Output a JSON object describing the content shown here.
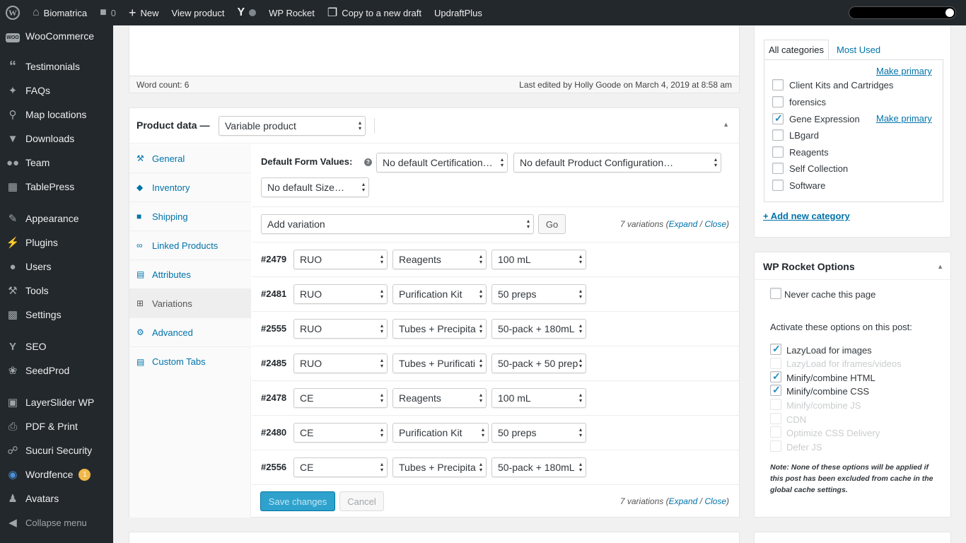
{
  "admin_bar": {
    "site_name": "Biomatrica",
    "comments_count": "0",
    "new_label": "New",
    "view_product_label": "View product",
    "wp_rocket_label": "WP Rocket",
    "copy_draft_label": "Copy to a new draft",
    "updraft_label": "UpdraftPlus"
  },
  "sidebar": {
    "items": [
      {
        "label": "WooCommerce",
        "icon": "woocommerce-icon"
      },
      {
        "label": "Testimonials",
        "icon": "quote-icon"
      },
      {
        "label": "FAQs",
        "icon": "pin-icon"
      },
      {
        "label": "Map locations",
        "icon": "map-pin-icon"
      },
      {
        "label": "Downloads",
        "icon": "download-icon"
      },
      {
        "label": "Team",
        "icon": "team-icon"
      },
      {
        "label": "TablePress",
        "icon": "table-icon"
      },
      {
        "label": "Appearance",
        "icon": "brush-icon"
      },
      {
        "label": "Plugins",
        "icon": "plugin-icon"
      },
      {
        "label": "Users",
        "icon": "user-icon"
      },
      {
        "label": "Tools",
        "icon": "wrench-icon"
      },
      {
        "label": "Settings",
        "icon": "settings-icon"
      },
      {
        "label": "SEO",
        "icon": "yoast-icon"
      },
      {
        "label": "SeedProd",
        "icon": "seed-icon"
      },
      {
        "label": "LayerSlider WP",
        "icon": "layers-icon"
      },
      {
        "label": "PDF & Print",
        "icon": "printer-icon"
      },
      {
        "label": "Sucuri Security",
        "icon": "shield-icon"
      },
      {
        "label": "Wordfence",
        "icon": "wordfence-icon"
      },
      {
        "label": "Avatars",
        "icon": "avatar-icon"
      }
    ],
    "wordfence_badge": "1",
    "collapse_label": "Collapse menu"
  },
  "editor": {
    "word_count": "Word count: 6",
    "last_edited": "Last edited by Holly Goode on March 4, 2019 at 8:58 am"
  },
  "product_data": {
    "title": "Product data —",
    "type_selected": "Variable product",
    "tabs": [
      "General",
      "Inventory",
      "Shipping",
      "Linked Products",
      "Attributes",
      "Variations",
      "Advanced",
      "Custom Tabs"
    ],
    "active_tab": "Variations",
    "default_form_label": "Default Form Values:",
    "default_certification": "No default Certification…",
    "default_configuration": "No default Product Configuration…",
    "default_size": "No default Size…",
    "add_variation": "Add variation",
    "go_label": "Go",
    "variation_count_text": "7 variations",
    "expand_label": "Expand",
    "slash": " / ",
    "close_label": "Close",
    "variations": [
      {
        "id": "#2479",
        "cert": "RUO",
        "config": "Reagents",
        "size": "100 mL"
      },
      {
        "id": "#2481",
        "cert": "RUO",
        "config": "Purification Kit",
        "size": "50 preps"
      },
      {
        "id": "#2555",
        "cert": "RUO",
        "config": "Tubes + Precipita",
        "size": "50-pack + 180mL"
      },
      {
        "id": "#2485",
        "cert": "RUO",
        "config": "Tubes + Purificati",
        "size": "50-pack + 50 prep"
      },
      {
        "id": "#2478",
        "cert": "CE",
        "config": "Reagents",
        "size": "100 mL"
      },
      {
        "id": "#2480",
        "cert": "CE",
        "config": "Purification Kit",
        "size": "50 preps"
      },
      {
        "id": "#2556",
        "cert": "CE",
        "config": "Tubes + Precipita",
        "size": "50-pack + 180mL"
      }
    ],
    "save_label": "Save changes",
    "cancel_label": "Cancel"
  },
  "categories": {
    "tab_all": "All categories",
    "tab_most_used": "Most Used",
    "make_primary": "Make primary",
    "items": [
      {
        "label": "Client Kits and Cartridges",
        "checked": false
      },
      {
        "label": "forensics",
        "checked": false
      },
      {
        "label": "Gene Expression",
        "checked": true
      },
      {
        "label": "LBgard",
        "checked": false
      },
      {
        "label": "Reagents",
        "checked": false
      },
      {
        "label": "Self Collection",
        "checked": false
      },
      {
        "label": "Software",
        "checked": false
      }
    ],
    "add_new": "+ Add new category"
  },
  "wp_rocket": {
    "title": "WP Rocket Options",
    "never_cache": "Never cache this page",
    "activate_label": "Activate these options on this post:",
    "options": [
      {
        "label": "LazyLoad for images",
        "checked": true,
        "disabled": false
      },
      {
        "label": "LazyLoad for iframes/videos",
        "checked": false,
        "disabled": true
      },
      {
        "label": "Minify/combine HTML",
        "checked": true,
        "disabled": false
      },
      {
        "label": "Minify/combine CSS",
        "checked": true,
        "disabled": false
      },
      {
        "label": "Minify/combine JS",
        "checked": false,
        "disabled": true
      },
      {
        "label": "CDN",
        "checked": false,
        "disabled": true
      },
      {
        "label": "Optimize CSS Delivery",
        "checked": false,
        "disabled": true
      },
      {
        "label": "Defer JS",
        "checked": false,
        "disabled": true
      }
    ],
    "note": "Note: None of these options will be applied if this post has been excluded from cache in the global cache settings."
  },
  "colors": {
    "admin_bg": "#23282d",
    "link": "#0073aa",
    "primary_button": "#2ea2cc",
    "checkmark": "#1e8cbe"
  }
}
